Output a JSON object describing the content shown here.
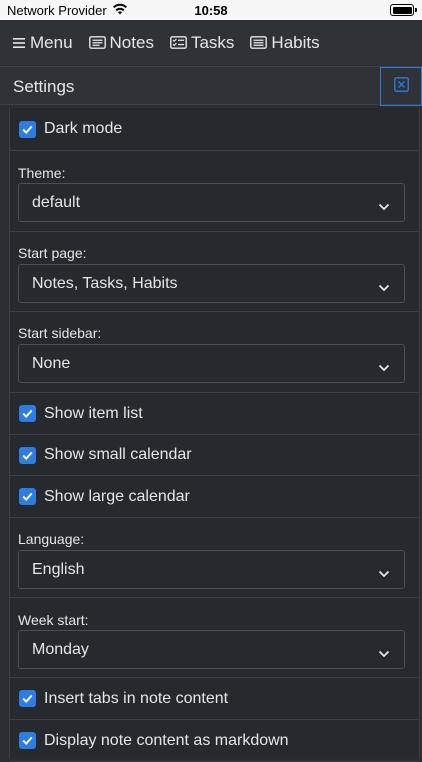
{
  "status_bar": {
    "carrier": "Network Provider",
    "time": "10:58",
    "wifi_icon": "wifi-icon",
    "battery_icon": "battery-icon"
  },
  "nav": {
    "menu": "Menu",
    "notes": "Notes",
    "tasks": "Tasks",
    "habits": "Habits"
  },
  "settings": {
    "title": "Settings",
    "close_icon": "close-icon",
    "dark_mode": {
      "label": "Dark mode",
      "checked": true
    },
    "theme": {
      "label": "Theme:",
      "value": "default"
    },
    "start_page": {
      "label": "Start page:",
      "value": "Notes, Tasks, Habits"
    },
    "start_sidebar": {
      "label": "Start sidebar:",
      "value": "None"
    },
    "show_item_list": {
      "label": "Show item list",
      "checked": true
    },
    "show_small_calendar": {
      "label": "Show small calendar",
      "checked": true
    },
    "show_large_calendar": {
      "label": "Show large calendar",
      "checked": true
    },
    "language": {
      "label": "Language:",
      "value": "English"
    },
    "week_start": {
      "label": "Week start:",
      "value": "Monday"
    },
    "insert_tabs": {
      "label": "Insert tabs in note content",
      "checked": true
    },
    "display_markdown": {
      "label": "Display note content as markdown",
      "checked": true
    }
  },
  "colors": {
    "accent": "#2f7de1",
    "background": "#26292d",
    "header": "#2f3237",
    "text": "#e6e6e6"
  }
}
